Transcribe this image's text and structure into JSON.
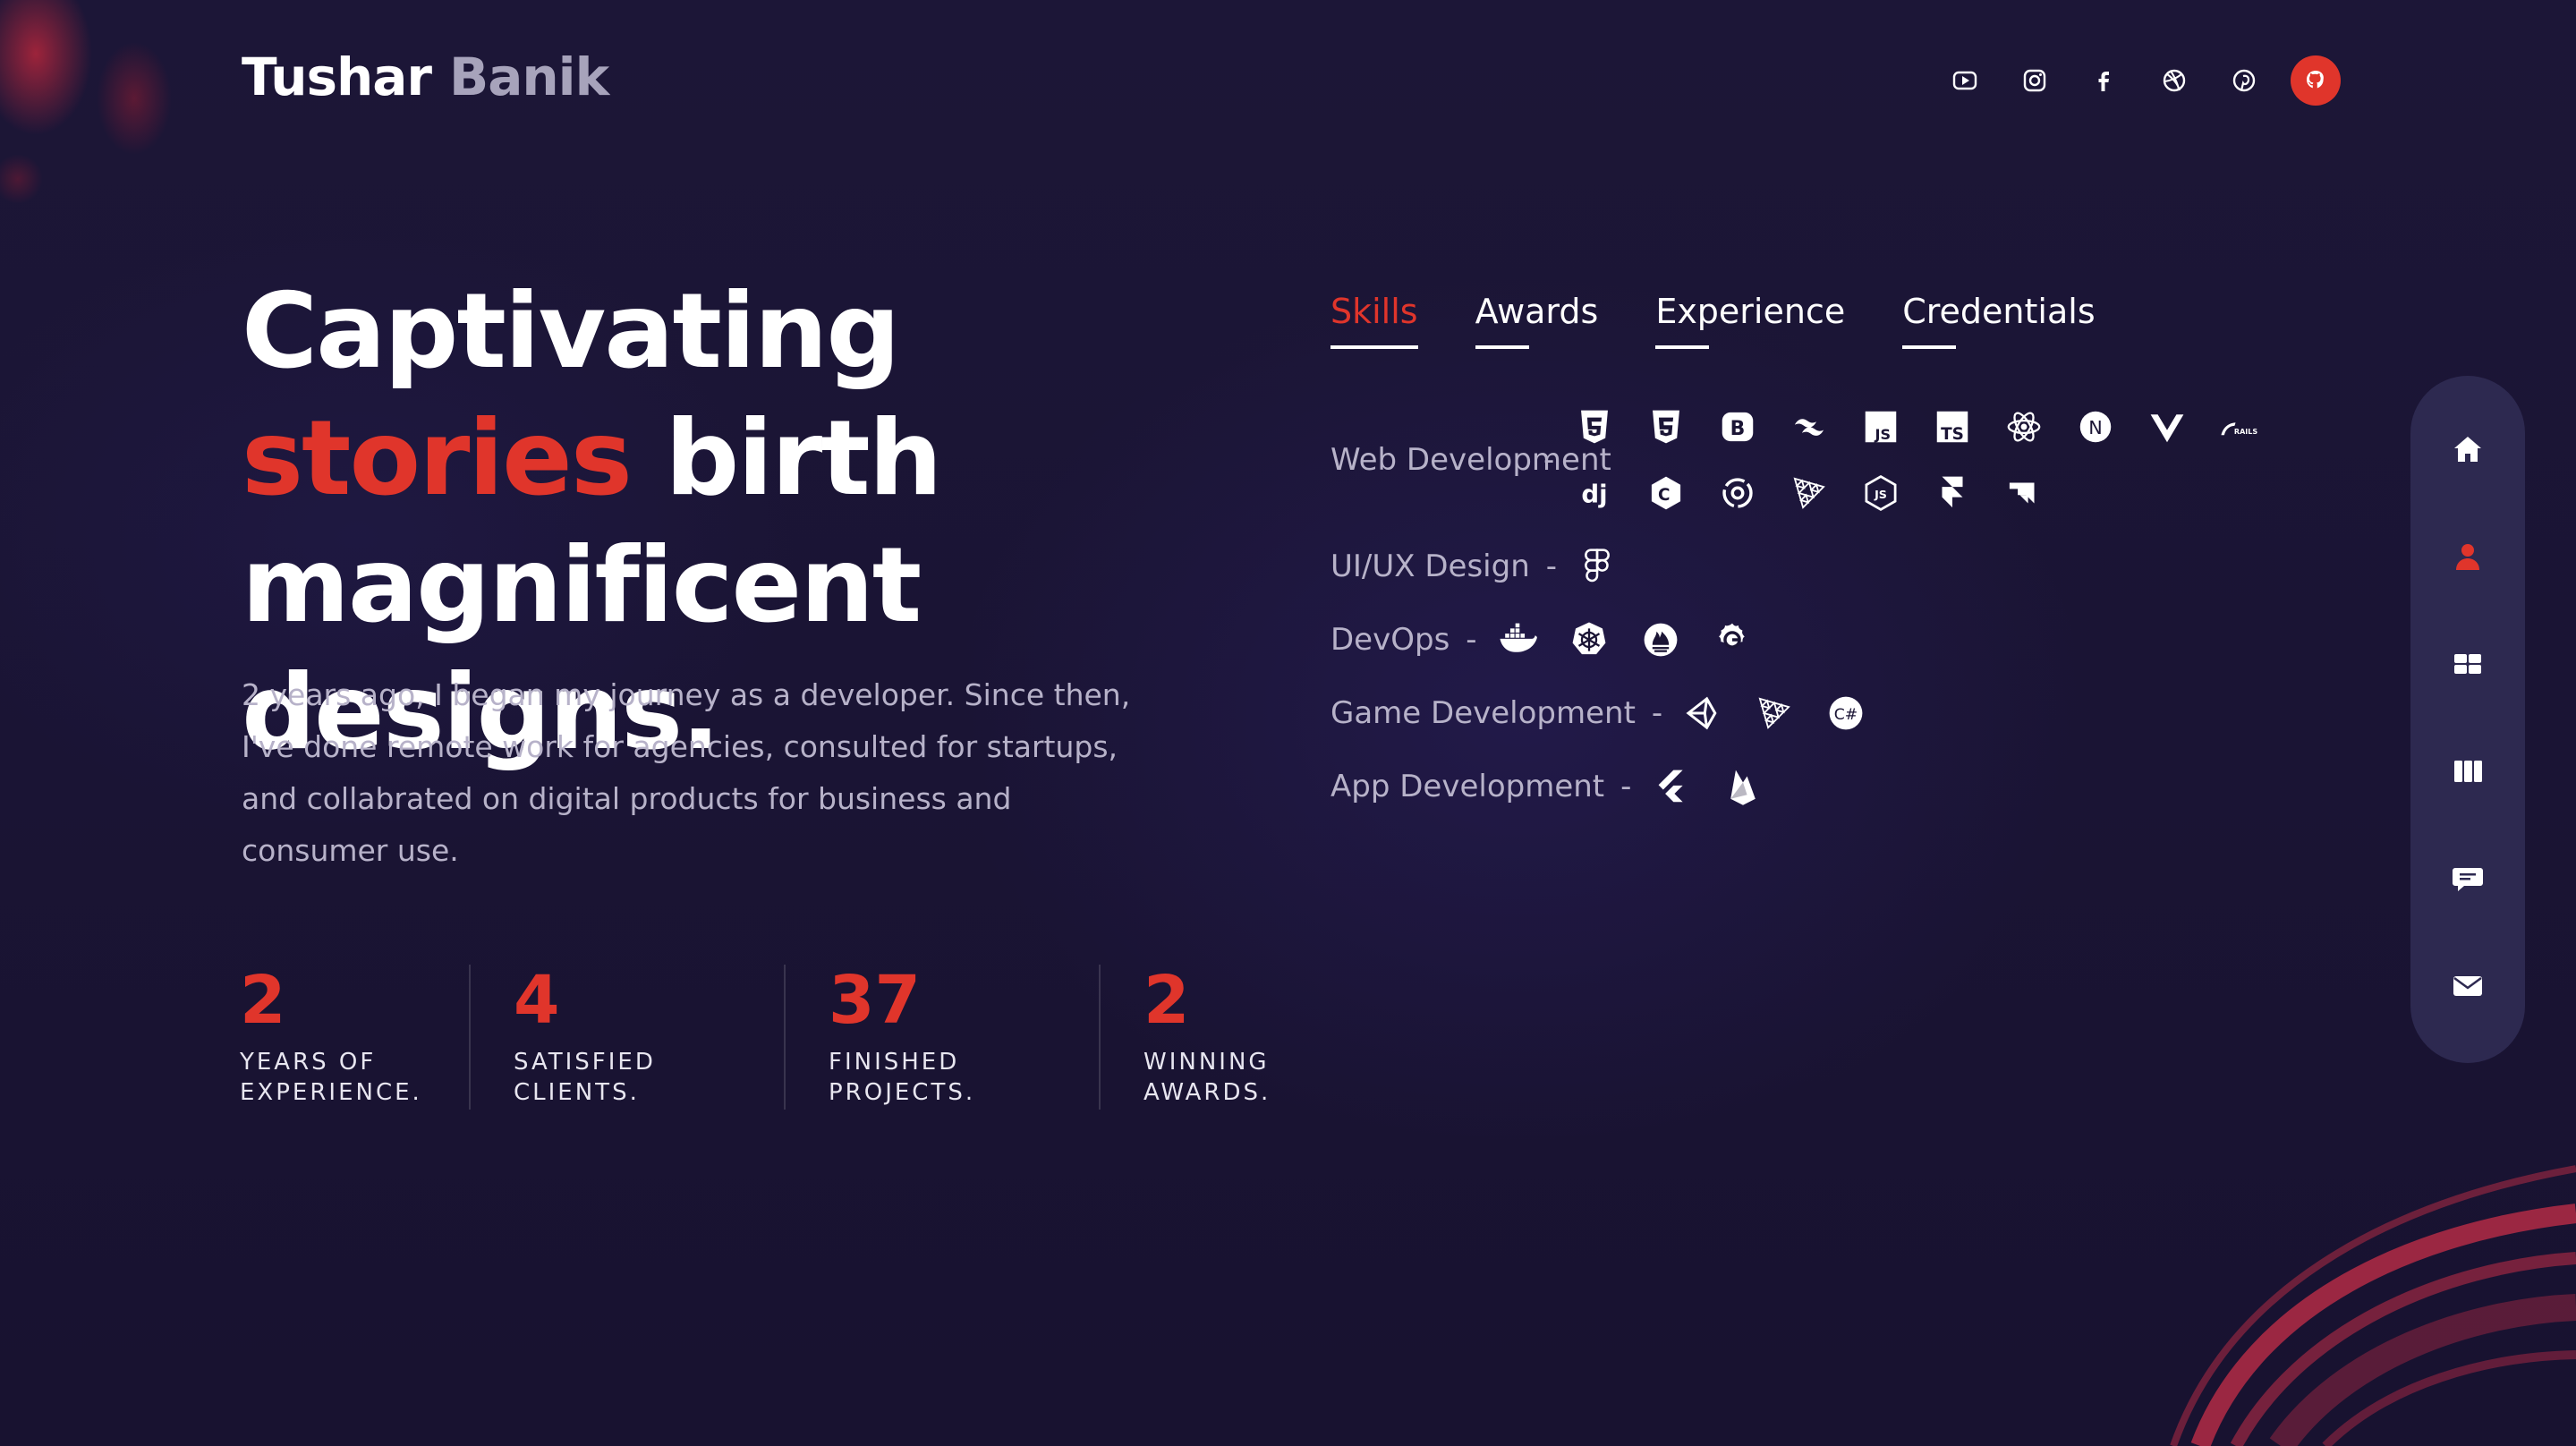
{
  "header": {
    "logo_first": "Tushar",
    "logo_last": "Banik",
    "socials": [
      {
        "name": "youtube-icon"
      },
      {
        "name": "instagram-icon"
      },
      {
        "name": "facebook-icon"
      },
      {
        "name": "dribbble-icon"
      },
      {
        "name": "pinterest-icon"
      },
      {
        "name": "github-icon",
        "active": true
      }
    ]
  },
  "hero": {
    "headline_pre": "Captivating ",
    "headline_accent": "stories",
    "headline_post": " birth magnificent designs.",
    "intro": "2 years ago, I began my journey as a developer. Since then, I've done remote work for agencies, consulted for startups, and collabrated on digital products for business and consumer use."
  },
  "stats": [
    {
      "value": "2",
      "label": "YEARS OF EXPERIENCE."
    },
    {
      "value": "4",
      "label": "SATISFIED CLIENTS."
    },
    {
      "value": "37",
      "label": "FINISHED PROJECTS."
    },
    {
      "value": "2",
      "label": "WINNING AWARDS."
    }
  ],
  "tabs": [
    {
      "label": "Skills",
      "active": true
    },
    {
      "label": "Awards"
    },
    {
      "label": "Experience"
    },
    {
      "label": "Credentials"
    }
  ],
  "skills": [
    {
      "label": "Web Development",
      "icons": [
        "html5-icon",
        "css3-icon",
        "bootstrap-icon",
        "tailwind-icon",
        "javascript-icon",
        "typescript-icon",
        "react-icon",
        "nextjs-icon",
        "vue-icon",
        "rails-icon",
        "django-icon",
        "cplusplus-icon",
        "opencv-icon",
        "threejs-icon",
        "nodejs-icon",
        "framer-icon",
        "kernel-icon"
      ]
    },
    {
      "label": "UI/UX Design",
      "icons": [
        "figma-icon"
      ]
    },
    {
      "label": "DevOps",
      "icons": [
        "docker-icon",
        "kubernetes-icon",
        "prometheus-icon",
        "grafana-icon"
      ]
    },
    {
      "label": "Game Development",
      "icons": [
        "unity-icon",
        "threejs-icon",
        "csharp-icon"
      ]
    },
    {
      "label": "App Development",
      "icons": [
        "flutter-icon",
        "firebase-icon"
      ]
    }
  ],
  "icon_text": {
    "bootstrap": "B",
    "javascript": "JS",
    "typescript": "TS",
    "nextjs": "N",
    "rails": "RAILS",
    "django": "dj",
    "cplusplus": "C",
    "nodejs": "JS",
    "csharp": "C#"
  },
  "sidenav": [
    {
      "name": "home-icon"
    },
    {
      "name": "about-icon",
      "active": true
    },
    {
      "name": "services-icon"
    },
    {
      "name": "portfolio-icon"
    },
    {
      "name": "testimonials-icon"
    },
    {
      "name": "contact-icon"
    }
  ],
  "colors": {
    "accent": "#e0352b",
    "background": "#1b1535",
    "muted_text": "#b7b2c9",
    "sidenav_bg": "#2d2950"
  }
}
